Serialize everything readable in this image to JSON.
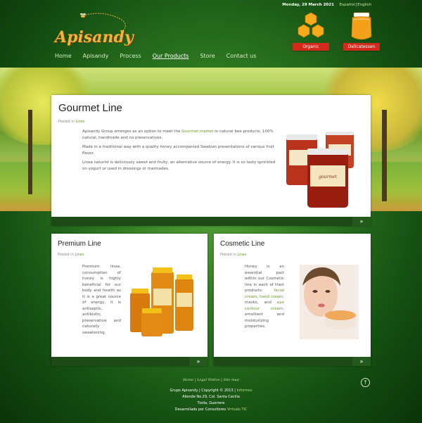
{
  "topbar": {
    "date": "Monday, 29 March 2021",
    "lang_es": "Español",
    "lang_sep": "|",
    "lang_en": "English"
  },
  "brand": {
    "logo_text": "Apisandy",
    "accent": "#f2b33a"
  },
  "badges": [
    {
      "label": "Organic",
      "icon": "honeycomb-icon"
    },
    {
      "label": "Delicatessen",
      "icon": "honey-jar-icon"
    }
  ],
  "nav": [
    {
      "label": "Home"
    },
    {
      "label": "Apisandy"
    },
    {
      "label": "Process"
    },
    {
      "label": "Our Products",
      "active": true
    },
    {
      "label": "Store"
    },
    {
      "label": "Contact us"
    }
  ],
  "main": {
    "title": "Gourmet Line",
    "posted_prefix": "Posted in",
    "posted_link": "Lines",
    "p1_a": "Apisandy Group emerges as an option to meet the ",
    "p1_link": "Gourmet market",
    "p1_b": " in natural bee products, 100% natural, handmade and no preservatives.",
    "p2": "Made in a traditional way with a quality honey accompanied Swabian presentations of various fruit flavor.",
    "p3": "Linea naturist is deliciously sweet and fruity, an alternative source of energy. It is so tasty sprinkled on yogurt or used in dressings or marinades.",
    "more": "»"
  },
  "premium": {
    "title": "Premium Line",
    "posted_prefix": "Posted in",
    "posted_link": "Lines",
    "text": "Premium linea, consumption of honey is highly beneficial for our body and health as it is a great source of energy, it is antiseptic, antibiotic, preservative and naturally sweetening.",
    "more": "»"
  },
  "cosmetic": {
    "title": "Cosmetic Line",
    "posted_prefix": "Posted in",
    "posted_link": "Lines",
    "text_a": "Honey is an essential part within our Cosmetic line in each of their products: ",
    "link1": "facial cream",
    "comma1": ", ",
    "link2": "hand cream",
    "text_b": ", masks, and ",
    "link3": "eye contour cream",
    "text_c": ", emollient and moisturizing properties.",
    "more": "»"
  },
  "footer": {
    "link_home": "Home",
    "sep": "|",
    "link_legal": "Legal Notice",
    "link_site": "Site map",
    "line1_a": "Grupo Apisandy | Copyright © 2013 | ",
    "line1_link": "Informes",
    "line2": "Allende No.29, Col. Santa Cecilia",
    "line3": "Tixtla, Guerrero",
    "line4_a": "Desarrollado por Consultores ",
    "line4_link": "Virtuals TIC",
    "totop": "↑"
  }
}
